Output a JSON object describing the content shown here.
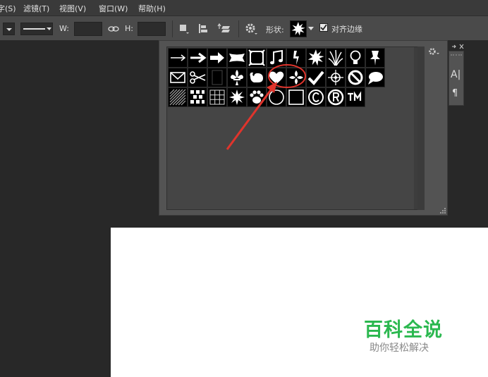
{
  "menu": {
    "items": [
      {
        "label": "字(S)"
      },
      {
        "label": "滤镜(T)"
      },
      {
        "label": "视图(V)"
      },
      {
        "label": "窗口(W)"
      },
      {
        "label": "帮助(H)"
      }
    ]
  },
  "options": {
    "w_label": "W:",
    "h_label": "H:",
    "shape_label": "形状:",
    "align_edges_label": "对齐边缘",
    "align_edges_checked": true
  },
  "shape_picker": {
    "rows": [
      [
        "arrow-thin",
        "arrow-medium",
        "arrow-bold",
        "banner",
        "frame",
        "music-note",
        "lightning",
        "starburst",
        "grass",
        "lightbulb",
        "pushpin"
      ],
      [
        "envelope",
        "scissors",
        "blank",
        "fleur-de-lis",
        "hand-ornament",
        "heart",
        "puzzle-flower",
        "checkmark",
        "target",
        "no-sign",
        "speech-bubble"
      ],
      [
        "hatch",
        "checker",
        "grid",
        "burst",
        "paw",
        "circle",
        "square",
        "copyright",
        "registered",
        "trademark"
      ]
    ],
    "selected": "heart"
  },
  "side_panel": {
    "char_label": "A|",
    "para_label": "¶"
  },
  "watermark": {
    "title": "百科全说",
    "subtitle": "助你轻松解决"
  },
  "colors": {
    "highlight": "#e0342c",
    "watermark_green": "#2bb84f"
  }
}
